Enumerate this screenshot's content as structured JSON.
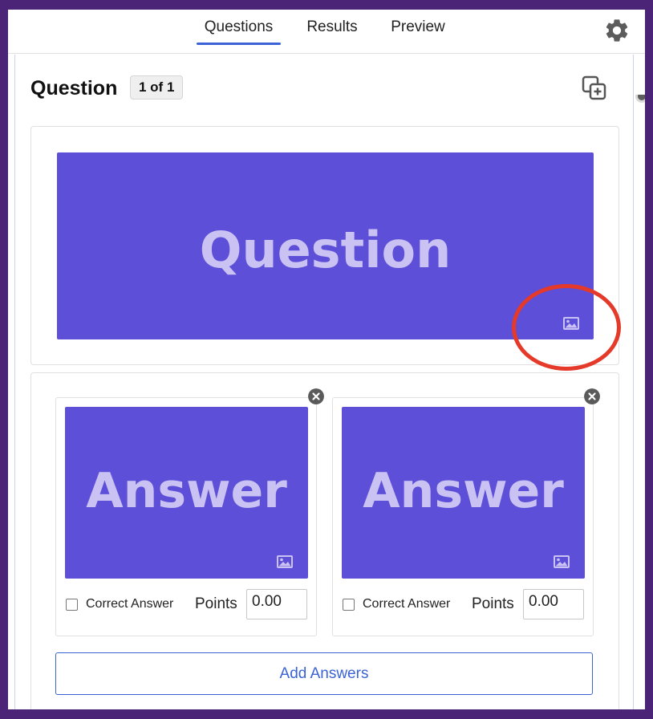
{
  "nav": {
    "tabs": [
      {
        "label": "Questions",
        "active": true
      },
      {
        "label": "Results",
        "active": false
      },
      {
        "label": "Preview",
        "active": false
      }
    ],
    "settings_icon": "gear-icon"
  },
  "question": {
    "title": "Question",
    "counter": "1 of 1",
    "duplicate_icon": "copy-add-icon",
    "banner_text": "Question",
    "banner_color": "#5d4fd8",
    "image_icon": "image-icon"
  },
  "answers": {
    "items": [
      {
        "banner_text": "Answer",
        "correct_label": "Correct Answer",
        "points_label": "Points",
        "points_value": "0.00",
        "checked": false
      },
      {
        "banner_text": "Answer",
        "correct_label": "Correct Answer",
        "points_label": "Points",
        "points_value": "0.00",
        "checked": false
      }
    ],
    "add_label": "Add Answers"
  },
  "colors": {
    "accent": "#3b63d6",
    "frame": "#4b2478",
    "highlight": "#e5392a",
    "banner_text": "#c9c2f2"
  }
}
